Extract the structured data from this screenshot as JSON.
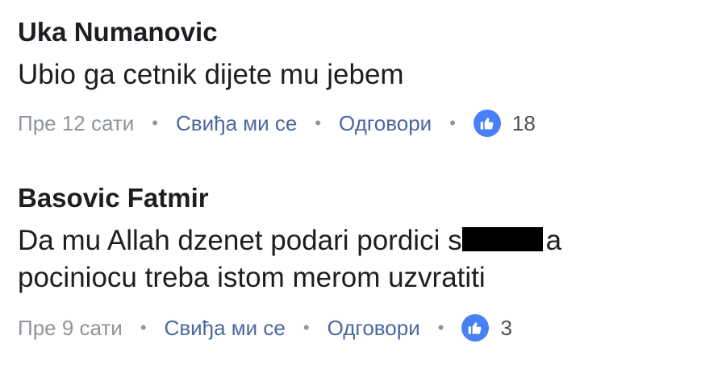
{
  "comments": [
    {
      "author": "Uka Numanovic",
      "text_line_1": "Ubio ga cetnik dijete mu jebem",
      "time": "Пре 12 сати",
      "like_label": "Свиђа ми се",
      "reply_label": "Одговори",
      "like_count": "18",
      "separator": "•"
    },
    {
      "author": "Basovic Fatmir",
      "text_line_1_start": "Da mu Allah dzenet podari pordici s",
      "text_line_1_end": "a",
      "text_line_2": "pociniocu treba istom merom uzvratiti",
      "time": "Пре 9 сати",
      "like_label": "Свиђа ми се",
      "reply_label": "Одговори",
      "like_count": "3",
      "separator": "•"
    }
  ],
  "colors": {
    "author": "#1c1e21",
    "meta": "#90949c",
    "link": "#4b67a1",
    "like_icon_bg": "#4a80f5",
    "redaction": "#000000"
  },
  "icons": {
    "like": "thumbs-up-icon"
  }
}
